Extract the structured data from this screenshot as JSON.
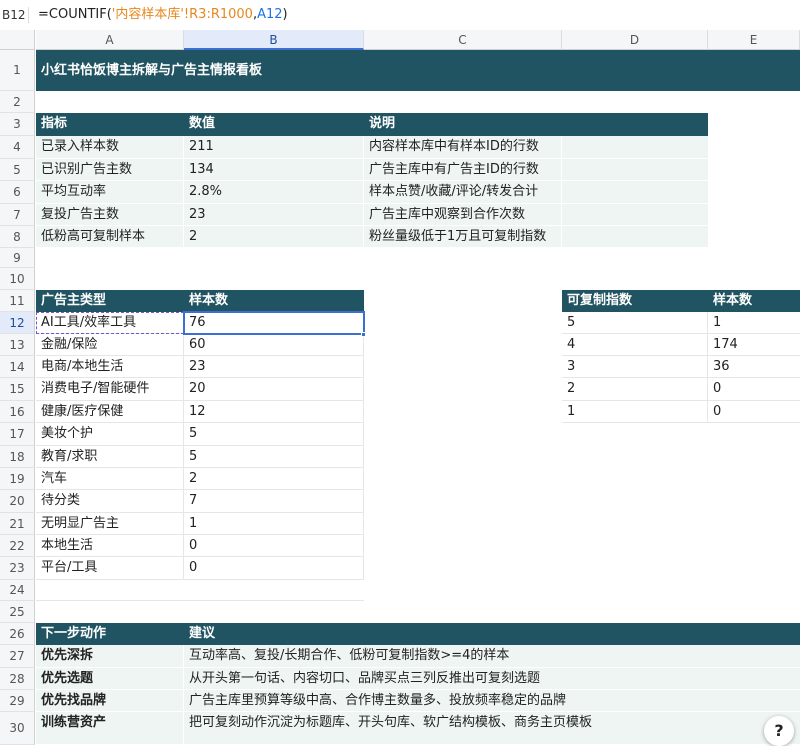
{
  "formula_bar": {
    "cell_ref": "B12",
    "formula_prefix": "=COUNTIF(",
    "formula_ref1": "'内容样本库'!R3:R1000",
    "formula_comma": ",",
    "formula_ref2": "A12",
    "formula_suffix": ")"
  },
  "columns": [
    "A",
    "B",
    "C",
    "D",
    "E"
  ],
  "rows": [
    "1",
    "2",
    "3",
    "4",
    "5",
    "6",
    "7",
    "8",
    "9",
    "10",
    "11",
    "12",
    "13",
    "14",
    "15",
    "16",
    "17",
    "18",
    "19",
    "20",
    "21",
    "22",
    "23",
    "24",
    "25",
    "26",
    "27",
    "28",
    "29",
    "30"
  ],
  "title": "小红书恰饭博主拆解与广告主情报看板",
  "metrics": {
    "headers": [
      "指标",
      "数值",
      "说明"
    ],
    "rows": [
      {
        "name": "已录入样本数",
        "value": "211",
        "desc": "内容样本库中有样本ID的行数"
      },
      {
        "name": "已识别广告主数",
        "value": "134",
        "desc": "广告主库中有广告主ID的行数"
      },
      {
        "name": "平均互动率",
        "value": "2.8%",
        "desc": "样本点赞/收藏/评论/转发合计"
      },
      {
        "name": "复投广告主数",
        "value": "23",
        "desc": "广告主库中观察到合作次数"
      },
      {
        "name": "低粉高可复制样本",
        "value": "2",
        "desc": "粉丝量级低于1万且可复制指数"
      }
    ]
  },
  "advertiser_types": {
    "headers": [
      "广告主类型",
      "样本数"
    ],
    "rows": [
      {
        "type": "AI工具/效率工具",
        "count": "76"
      },
      {
        "type": "金融/保险",
        "count": "60"
      },
      {
        "type": "电商/本地生活",
        "count": "23"
      },
      {
        "type": "消费电子/智能硬件",
        "count": "20"
      },
      {
        "type": "健康/医疗保健",
        "count": "12"
      },
      {
        "type": "美妆个护",
        "count": "5"
      },
      {
        "type": "教育/求职",
        "count": "5"
      },
      {
        "type": "汽车",
        "count": "2"
      },
      {
        "type": "待分类",
        "count": "7"
      },
      {
        "type": "无明显广告主",
        "count": "1"
      },
      {
        "type": "本地生活",
        "count": "0"
      },
      {
        "type": "平台/工具",
        "count": "0"
      }
    ]
  },
  "replicability": {
    "headers": [
      "可复制指数",
      "样本数"
    ],
    "rows": [
      {
        "index": "5",
        "count": "1"
      },
      {
        "index": "4",
        "count": "174"
      },
      {
        "index": "3",
        "count": "36"
      },
      {
        "index": "2",
        "count": "0"
      },
      {
        "index": "1",
        "count": "0"
      }
    ]
  },
  "next_steps": {
    "headers": [
      "下一步动作",
      "建议"
    ],
    "rows": [
      {
        "action": "优先深拆",
        "advice": "互动率高、复投/长期合作、低粉可复制指数>=4的样本"
      },
      {
        "action": "优先选题",
        "advice": "从开头第一句话、内容切口、品牌买点三列反推出可复刻选题"
      },
      {
        "action": "优先找品牌",
        "advice": "广告主库里预算等级中高、合作博主数量多、投放频率稳定的品牌"
      },
      {
        "action": "训练营资产",
        "advice": "把可复刻动作沉淀为标题库、开头句库、软广结构模板、商务主页模板"
      }
    ]
  },
  "help_button": "?",
  "colors": {
    "header_dark": "#215462",
    "row_light": "#eef5f3",
    "selection": "#3b6fd1",
    "formula_ref1": "#e8871e",
    "formula_ref2": "#1a73e8"
  }
}
